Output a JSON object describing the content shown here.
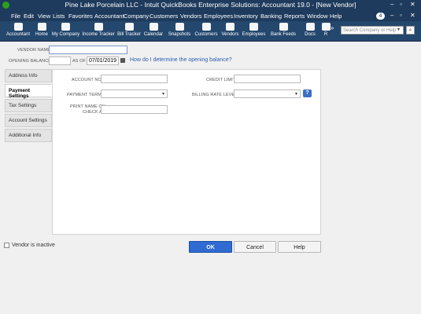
{
  "window": {
    "title": "Pine Lake Porcelain LLC  - Intuit QuickBooks Enterprise Solutions: Accountant 19.0 - [New Vendor]",
    "controls": [
      "–",
      "▫",
      "✕"
    ]
  },
  "menu": {
    "items": [
      "File",
      "Edit",
      "View",
      "Lists",
      "Favorites",
      "Accountant",
      "Company",
      "Customers",
      "Vendors",
      "Employees",
      "Inventory",
      "Banking",
      "Reports",
      "Window",
      "Help"
    ],
    "notification_count": "4",
    "controls": [
      "–",
      "▫",
      "✕"
    ]
  },
  "toolbar": {
    "items": [
      "Accountant",
      "Home",
      "My Company",
      "Income Tracker",
      "Bill Tracker",
      "Calendar",
      "Snapshots",
      "Customers",
      "Vendors",
      "Employees",
      "Bank Feeds",
      "Docs",
      "R"
    ],
    "more": "»",
    "search_placeholder": "Search Company or Help",
    "search_dropdown": "▾",
    "search_button": "⌕"
  },
  "form": {
    "vendor_name_label": "VENDOR NAME",
    "vendor_name_value": "",
    "opening_balance_label": "OPENING BALANCE",
    "opening_balance_value": "",
    "as_of_label": "AS OF",
    "as_of_value": "07/01/2019",
    "opening_balance_help": "How do I determine the opening balance?"
  },
  "tabs": [
    "Address Info",
    "Payment Settings",
    "Tax Settings",
    "Account Settings",
    "Additional Info"
  ],
  "active_tab": "Payment Settings",
  "payment": {
    "account_no_label": "ACCOUNT NO.",
    "account_no_value": "",
    "credit_limit_label": "CREDIT LIMIT",
    "credit_limit_value": "",
    "payment_terms_label": "PAYMENT TERMS",
    "payment_terms_value": "",
    "billing_rate_level_label": "BILLING RATE LEVEL",
    "billing_rate_level_value": "",
    "billing_rate_help": "?",
    "print_name_label_line1": "PRINT NAME ON",
    "print_name_label_line2": "CHECK AS",
    "print_name_value": ""
  },
  "footer": {
    "vendor_inactive_label": "Vendor is inactive",
    "vendor_inactive_checked": false,
    "ok_label": "OK",
    "cancel_label": "Cancel",
    "help_label": "Help"
  }
}
